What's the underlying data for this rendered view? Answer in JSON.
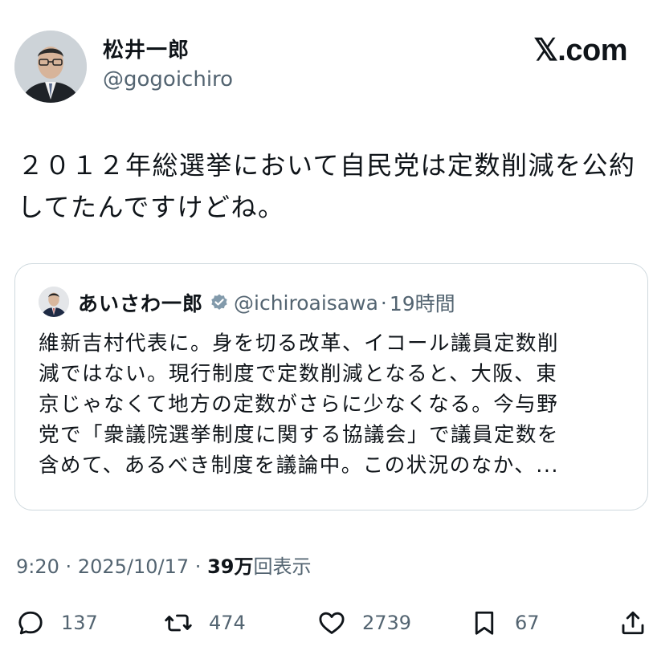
{
  "author": {
    "display_name": "松井一郎",
    "handle": "@gogoichiro",
    "avatar_icon": "person-avatar-icon"
  },
  "brand": "𝕏.com",
  "tweet": {
    "line1": "２０１２年総選挙において自民党は定数削減を公約",
    "line2": "してたんですけどね。"
  },
  "quote": {
    "display_name": "あいさわ一郎",
    "verified_icon": "verified-badge-icon",
    "handle": "@ichiroaisawa",
    "separator": "·",
    "time": "19時間",
    "lines": [
      "維新吉村代表に。身を切る改革、イコール議員定数削",
      "減ではない。現行制度で定数削減となると、大阪、東",
      "京じゃなくて地方の定数がさらに少なくなる。今与野",
      "党で「衆議院選挙制度に関する協議会」で議員定数を",
      "含めて、あるべき制度を議論中。この状況のなか、..."
    ]
  },
  "meta": {
    "time": "9:20",
    "separator": "·",
    "date": "2025/10/17",
    "views_number": "39万",
    "views_label": "回表示"
  },
  "actions": {
    "reply": "137",
    "repost": "474",
    "like": "2739",
    "bookmark": "67"
  },
  "colors": {
    "text": "#0f1419",
    "secondary": "#536471",
    "border": "#cfd9de",
    "verified": "#829aab"
  }
}
